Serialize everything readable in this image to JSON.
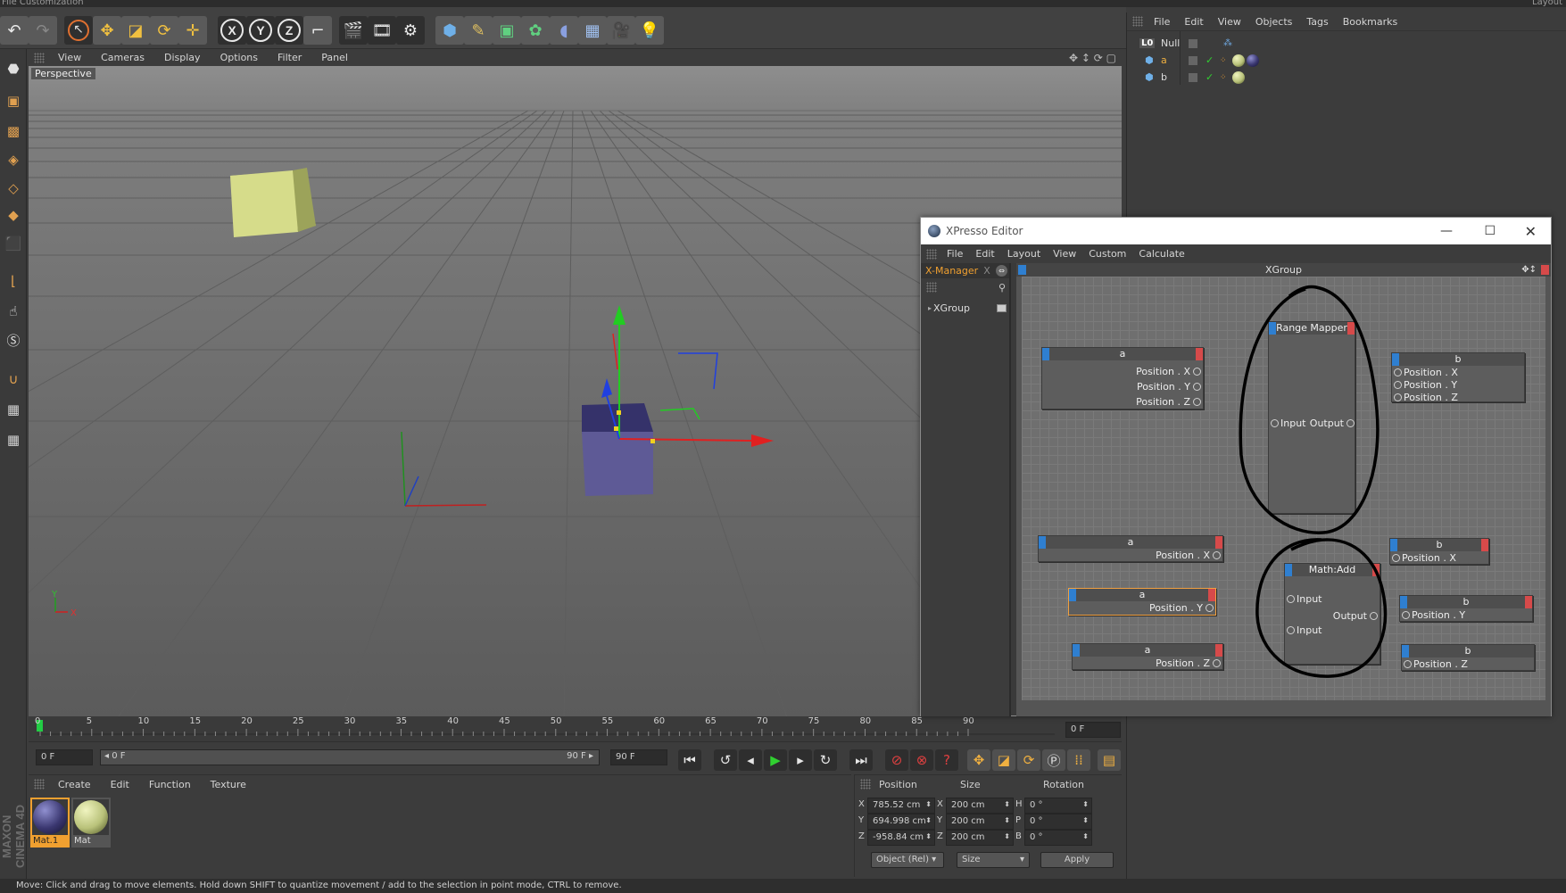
{
  "topstrip": {
    "left_text": "File   Customization",
    "right_text": "Layout"
  },
  "toolbar": {
    "buttons": [
      "undo-icon",
      "redo-icon",
      "select-icon",
      "move-icon",
      "scale-icon",
      "rotate-icon",
      "last-tool-icon",
      "x-axis-icon",
      "y-axis-icon",
      "z-axis-icon",
      "coordinate-system-icon",
      "render-view-icon",
      "render-picture-viewer-icon",
      "render-settings-icon",
      "cube-icon",
      "pen-icon",
      "subdivision-icon",
      "cloner-icon",
      "deformer-icon",
      "floor-icon",
      "camera-icon",
      "light-icon"
    ],
    "axis_x": "X",
    "axis_y": "Y",
    "axis_z": "Z"
  },
  "viewport": {
    "menu": [
      "View",
      "Cameras",
      "Display",
      "Options",
      "Filter",
      "Panel"
    ],
    "label": "Perspective",
    "colors": {
      "yellow_cube": "#d6dc8a",
      "blue_cube": "#5e5a96",
      "axis_x": "#e02020",
      "axis_y": "#20c020",
      "axis_z": "#2040e0"
    },
    "mini_axis_y": "Y",
    "mini_axis_x": "X"
  },
  "timeline": {
    "ticks": [
      "0",
      "5",
      "10",
      "15",
      "20",
      "25",
      "30",
      "35",
      "40",
      "45",
      "50",
      "55",
      "60",
      "65",
      "70",
      "75",
      "80",
      "85",
      "90"
    ],
    "current_frame": "0 F",
    "start_field": "0 F",
    "range_start": "◂ 0 F",
    "range_end": "90 F ▸",
    "end_field": "90 F"
  },
  "materials": {
    "menu": [
      "Create",
      "Edit",
      "Function",
      "Texture"
    ],
    "items": [
      {
        "name": "Mat.1",
        "color": "#3a3770"
      },
      {
        "name": "Mat",
        "color": "#b9c27a"
      }
    ]
  },
  "coords": {
    "headers": [
      "Position",
      "Size",
      "Rotation"
    ],
    "rows": [
      {
        "axis": "X",
        "pos": "785.52 cm",
        "size_axis": "X",
        "size": "200 cm",
        "rot_axis": "H",
        "rot": "0 °"
      },
      {
        "axis": "Y",
        "pos": "694.998 cm",
        "size_axis": "Y",
        "size": "200 cm",
        "rot_axis": "P",
        "rot": "0 °"
      },
      {
        "axis": "Z",
        "pos": "-958.84 cm",
        "size_axis": "Z",
        "size": "200 cm",
        "rot_axis": "B",
        "rot": "0 °"
      }
    ],
    "mode_select": "Object (Rel)",
    "size_select": "Size",
    "apply_label": "Apply"
  },
  "objmgr": {
    "menu": [
      "File",
      "Edit",
      "View",
      "Objects",
      "Tags",
      "Bookmarks"
    ],
    "objects": [
      {
        "name": "Null",
        "icon": "L0"
      },
      {
        "name": "a",
        "icon": "cube"
      },
      {
        "name": "b",
        "icon": "cube"
      }
    ]
  },
  "status": "Move: Click and drag to move elements. Hold down SHIFT to quantize movement / add to the selection in point mode, CTRL to remove.",
  "xpresso": {
    "title": "XPresso Editor",
    "menu": [
      "File",
      "Edit",
      "Layout",
      "View",
      "Custom",
      "Calculate"
    ],
    "tab_xmanager": "X-Manager",
    "tab_close": "X",
    "tree_item": "XGroup",
    "group_title": "XGroup",
    "nodes": {
      "a_top": {
        "title": "a",
        "ports": [
          "Position . X",
          "Position . Y",
          "Position . Z"
        ]
      },
      "range_mapper": {
        "title": "Range Mapper",
        "input": "Input",
        "output": "Output"
      },
      "b_top": {
        "title": "b",
        "ports": [
          "Position . X",
          "Position . Y",
          "Position . Z"
        ]
      },
      "a_x": {
        "title": "a",
        "port": "Position . X"
      },
      "a_y": {
        "title": "a",
        "port": "Position . Y"
      },
      "a_z": {
        "title": "a",
        "port": "Position . Z"
      },
      "math_add": {
        "title": "Math:Add",
        "input1": "Input",
        "input2": "Input",
        "output": "Output"
      },
      "b_x": {
        "title": "b",
        "port": "Position . X"
      },
      "b_y": {
        "title": "b",
        "port": "Position . Y"
      },
      "b_z": {
        "title": "b",
        "port": "Position . Z"
      }
    }
  }
}
